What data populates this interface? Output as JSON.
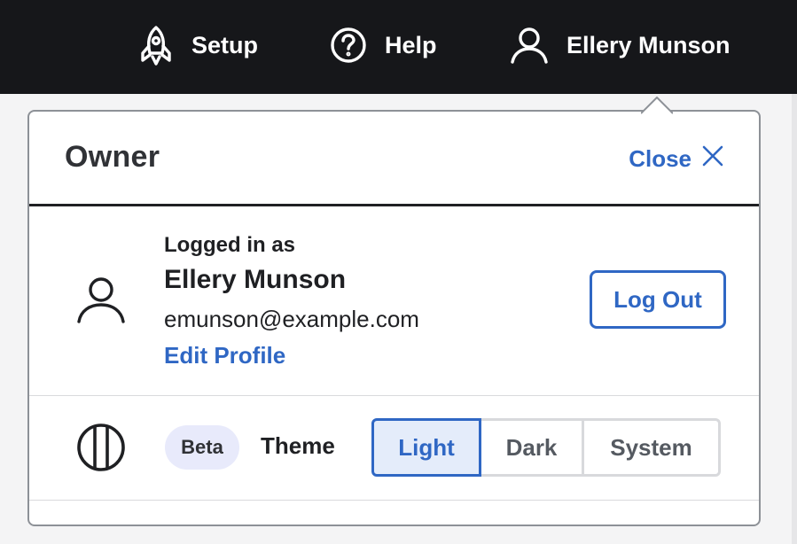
{
  "topbar": {
    "items": [
      {
        "label": "Setup",
        "icon": "rocket-icon"
      },
      {
        "label": "Help",
        "icon": "question-circle-icon"
      },
      {
        "label": "Ellery Munson",
        "icon": "user-icon"
      }
    ]
  },
  "popover": {
    "title": "Owner",
    "close_label": "Close",
    "profile": {
      "logged_in_label": "Logged in as",
      "name": "Ellery Munson",
      "email": "emunson@example.com",
      "edit_label": "Edit Profile",
      "logout_label": "Log Out"
    },
    "theme": {
      "badge": "Beta",
      "label": "Theme",
      "options": [
        "Light",
        "Dark",
        "System"
      ],
      "selected": "Light"
    }
  },
  "colors": {
    "topbar_bg": "#16171a",
    "accent": "#2f67c4",
    "badge_bg": "#e8eafb"
  }
}
